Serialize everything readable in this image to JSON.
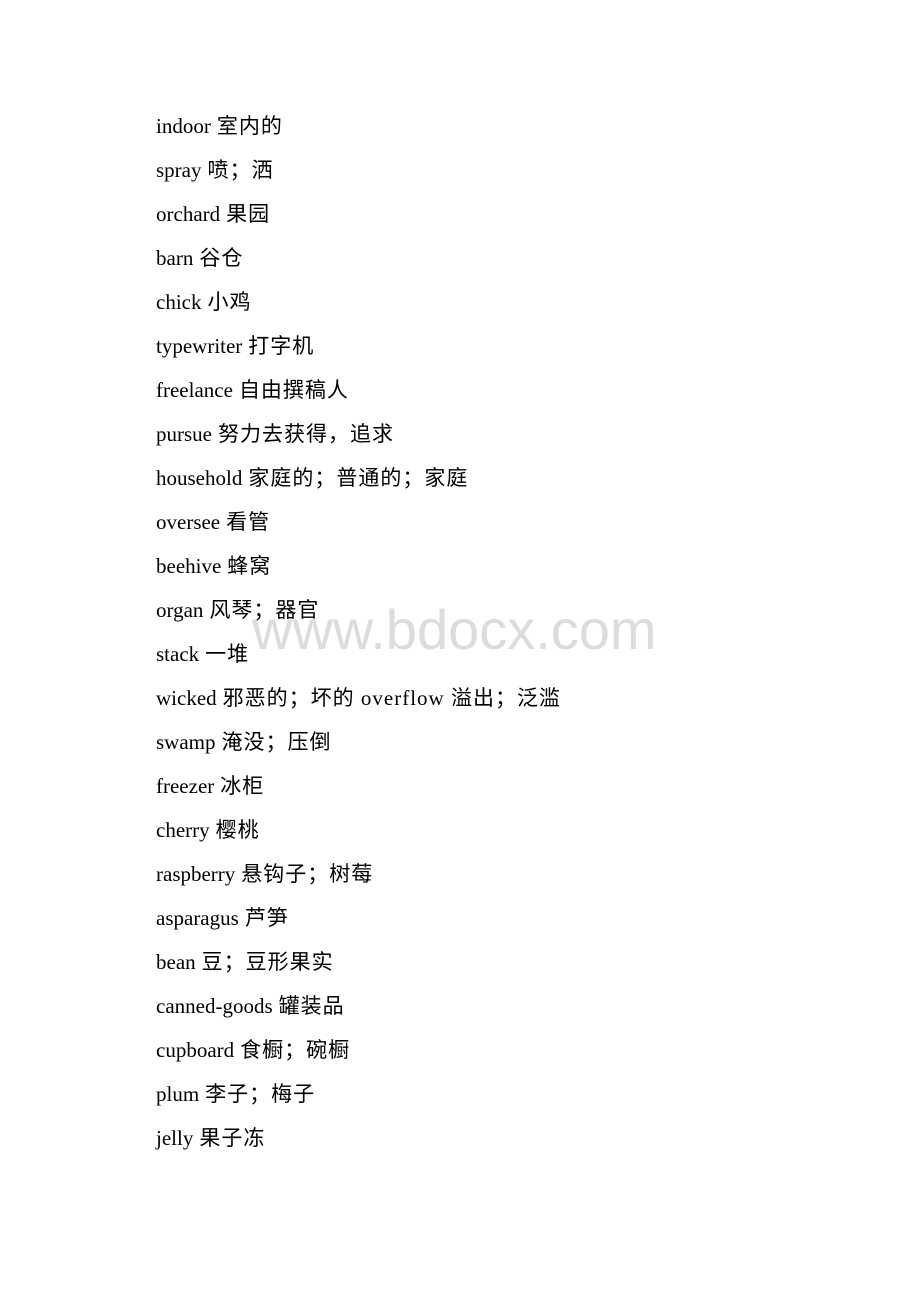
{
  "document": {
    "entries": [
      {
        "word": "indoor",
        "gloss": "室内的"
      },
      {
        "word": "spray",
        "gloss": "喷；洒"
      },
      {
        "word": "orchard",
        "gloss": "果园"
      },
      {
        "word": "barn",
        "gloss": "谷仓"
      },
      {
        "word": "chick",
        "gloss": "小鸡"
      },
      {
        "word": "typewriter",
        "gloss": "打字机"
      },
      {
        "word": "freelance",
        "gloss": "自由撰稿人"
      },
      {
        "word": "pursue",
        "gloss": "努力去获得，追求"
      },
      {
        "word": "household",
        "gloss": "家庭的；普通的；家庭"
      },
      {
        "word": "oversee",
        "gloss": "看管"
      },
      {
        "word": "beehive",
        "gloss": "蜂窝"
      },
      {
        "word": "organ",
        "gloss": "风琴；器官"
      },
      {
        "word": "stack",
        "gloss": "一堆"
      },
      {
        "word": "wicked",
        "gloss": "邪恶的；坏的 overflow 溢出；泛滥"
      },
      {
        "word": "swamp",
        "gloss": "淹没；压倒"
      },
      {
        "word": "freezer",
        "gloss": "冰柜"
      },
      {
        "word": "cherry",
        "gloss": "樱桃"
      },
      {
        "word": "raspberry",
        "gloss": "悬钩子；树莓"
      },
      {
        "word": "asparagus",
        "gloss": "芦笋"
      },
      {
        "word": "bean",
        "gloss": "豆；豆形果实"
      },
      {
        "word": "canned-goods",
        "gloss": "罐装品"
      },
      {
        "word": "cupboard",
        "gloss": "食橱；碗橱"
      },
      {
        "word": "plum",
        "gloss": "李子；梅子"
      },
      {
        "word": "jelly",
        "gloss": "果子冻"
      }
    ]
  },
  "watermark": {
    "text": "www.bdocx.com"
  }
}
